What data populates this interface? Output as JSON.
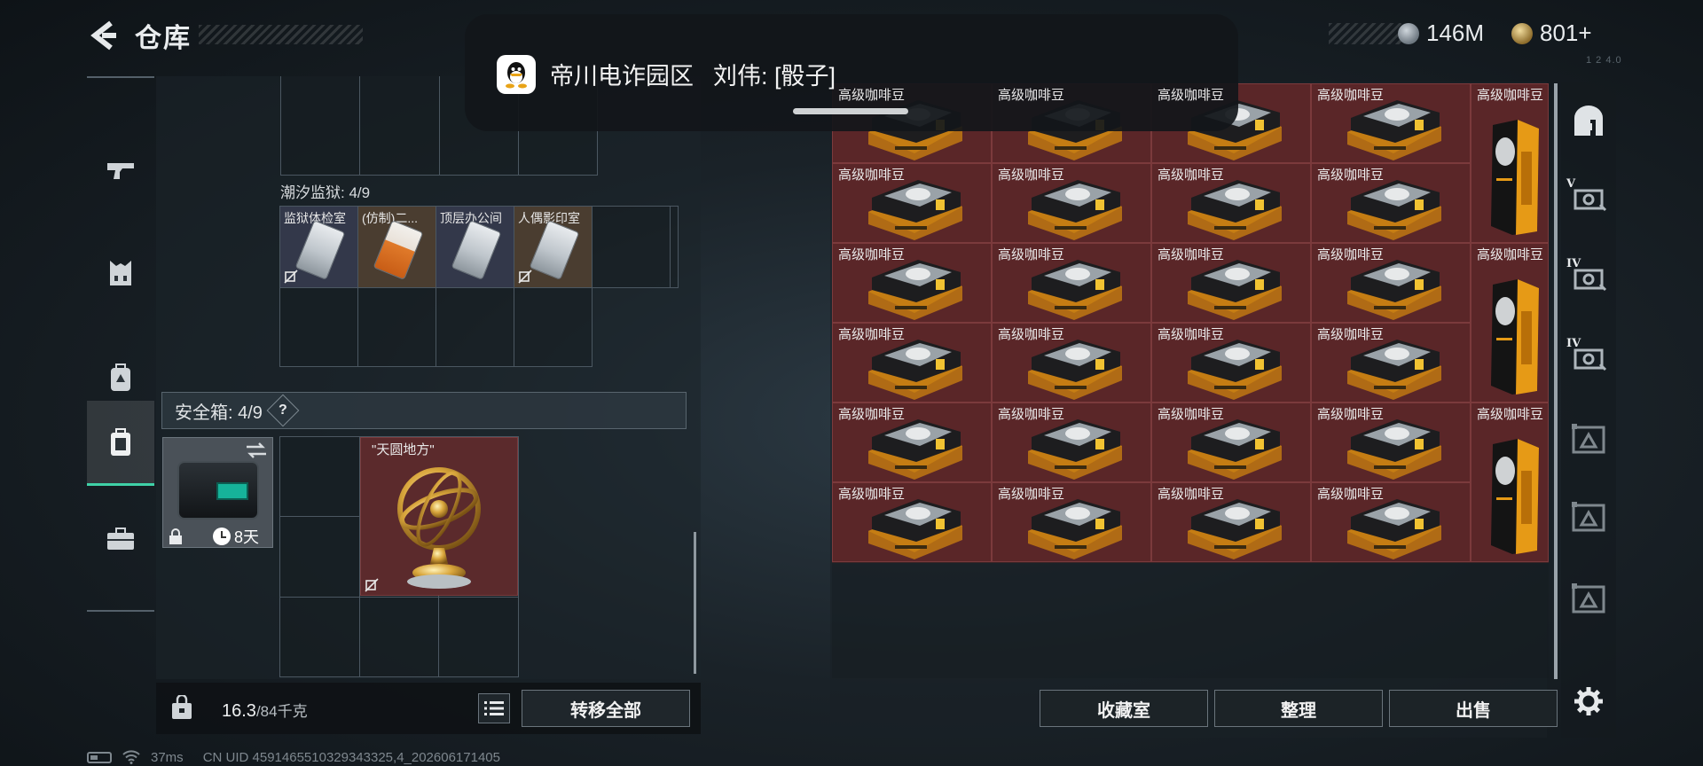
{
  "header": {
    "title": "仓库",
    "currency": [
      {
        "icon": "silver-coin-icon",
        "value": "146M"
      },
      {
        "icon": "gold-coin-icon",
        "value": "801+"
      }
    ],
    "tag": "1 2 4.0"
  },
  "notification": {
    "app_icon": "qq-penguin-icon",
    "sender": "帝川电诈园区",
    "message": "刘伟: [骰子]"
  },
  "left_sidebar": {
    "items": [
      {
        "icon": "pistol-icon",
        "active": false
      },
      {
        "icon": "armor-vest-icon",
        "active": false
      },
      {
        "icon": "backpack-icon",
        "active": false
      },
      {
        "icon": "safe-case-icon",
        "active": true
      },
      {
        "icon": "briefcase-icon",
        "active": false
      }
    ]
  },
  "left_panel": {
    "prison_label": "潮汐监狱: 4/9",
    "keys": [
      {
        "name": "监狱体检室",
        "style": "dark"
      },
      {
        "name": "(仿制)二...",
        "style": "brown"
      },
      {
        "name": "顶层办公间",
        "style": "dark"
      },
      {
        "name": "人偶影印室",
        "style": "brown"
      }
    ],
    "safebox_label": "安全箱: 4/9",
    "help": "?",
    "case_timer": "8天",
    "treasure_name": "\"天圆地方\"",
    "weight_current": "16.3",
    "weight_max": "/84千克",
    "transfer_all": "转移全部"
  },
  "warehouse": {
    "item_name": "高级咖啡豆",
    "pack_rows": 6,
    "pack_cols": 4,
    "tall_count": 3,
    "buttons": {
      "collection": "收藏室",
      "organize": "整理",
      "sell": "出售"
    }
  },
  "right_sidebar": {
    "items": [
      {
        "icon": "storage-home-icon",
        "label": ""
      },
      {
        "icon": "storage-tab-icon",
        "label": "V"
      },
      {
        "icon": "storage-tab-icon",
        "label": "IV"
      },
      {
        "icon": "storage-tab-icon",
        "label": "IV"
      },
      {
        "icon": "storage-tab-locked-icon",
        "label": ""
      },
      {
        "icon": "storage-tab-locked-icon",
        "label": ""
      },
      {
        "icon": "storage-tab-locked-icon",
        "label": ""
      }
    ],
    "settings_icon": "gear-icon"
  },
  "statusbar": {
    "ping": "37ms",
    "uid": "CN UID 4591465510329343325,4_202606171405"
  }
}
